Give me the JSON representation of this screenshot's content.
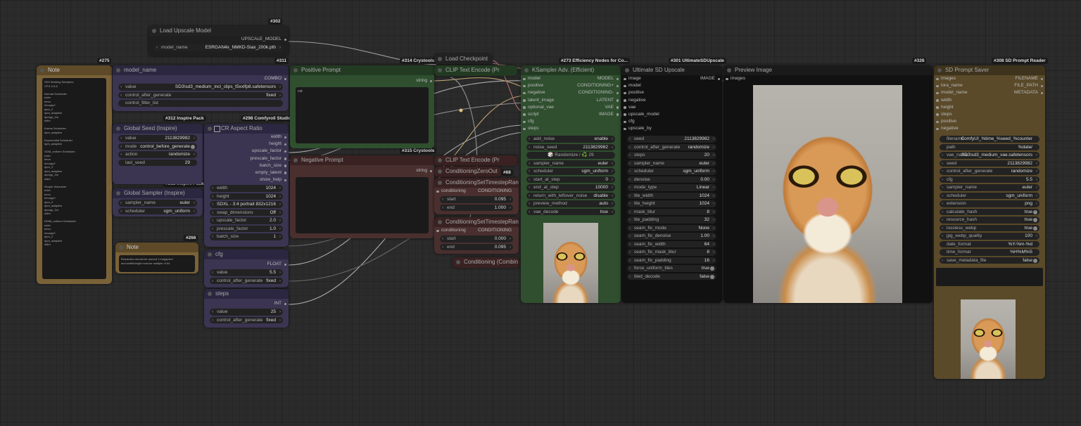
{
  "badges": {
    "b302": "#302",
    "b275": "#275",
    "b311": "#311",
    "b314": "#314 Crystools",
    "b273": "#273 Efficiency Nodes for Co...",
    "b301": "#301 UltimateSDUpscale",
    "b326": "#326",
    "b308": "#308 SD Prompt Reader",
    "b312": "#312 Inspire Pack",
    "b298": "#298 Comfyroll Studio",
    "b315": "#315 Crystools",
    "b313": "#313 Inspire Pack",
    "b266": "#266",
    "b68": "#68",
    "b322": "#322"
  },
  "upscale_loader": {
    "title": "Load Upscale Model",
    "output": "UPSCALE_MODEL",
    "model_label": "model_name",
    "model_value": "ESRGAN4x_NMKD-Siax_200k.pth"
  },
  "note1": {
    "title": "Note",
    "text": "SD3 Working Samplers\nCFG 4.5-6\n\nNormal Scheduler\neuler\nheun\nheunpp2\ndpm_2\ndpm_adaptive\ndpmpp_2m\nddim\n\nKarras Scheduler\ndpm_adaptive\n\nExponential Scheduler\ndpm_adaptive\n\nSGM_uniform Scheduler\neuler\nheun\nheunpp2\ndpm_2\ndpm_adaptive\ndpmpp_2m\nddim\n\nSimple Scheduler\neuler\nheun\nheunpp2\ndpm_2\ndpm_adaptive\ndpmpp_2m\nddim\n\nDDIM_uniform Scheduler\neuler\nheun\nheunpp2\ndpm_2\ndpm_adaptive\nddim"
  },
  "model_name_node": {
    "title": "model_name",
    "output": "COMBO",
    "value_label": "value",
    "value": "SD3\\sd3_medium_incl_clips_t5xxlfp8.safetensors",
    "cag_label": "control_after_generate",
    "cag_value": "fixed",
    "filter_label": "control_filter_list"
  },
  "global_seed": {
    "title": "Global Seed (Inspire)",
    "value_label": "value",
    "value": "2113829982",
    "mode_label": "mode",
    "mode_value": "control_before_generate",
    "action_label": "action",
    "action_value": "randomize",
    "last_seed_label": "last_seed",
    "last_seed_value": "29"
  },
  "global_sampler": {
    "title": "Global Sampler (Inspire)",
    "sampler_label": "sampler_name",
    "sampler_value": "euler",
    "scheduler_label": "scheduler",
    "scheduler_value": "sgm_uniform"
  },
  "note2": {
    "title": "Note",
    "text": "Resolution should be around 1 megapixel\nand width/height must be multiple of 64"
  },
  "aspect": {
    "title": "CR Aspect Ratio",
    "outputs": [
      "width",
      "height",
      "upscale_factor",
      "prescale_factor",
      "batch_size",
      "empty_latent",
      "show_help"
    ],
    "widgets": [
      {
        "label": "width",
        "value": "1024"
      },
      {
        "label": "height",
        "value": "1024"
      },
      {
        "label": "aspect_ratio",
        "value": "SDXL - 3:4 portrait 832x1216"
      },
      {
        "label": "swap_dimensions",
        "value": "Off"
      },
      {
        "label": "upscale_factor",
        "value": "2.0"
      },
      {
        "label": "prescale_factor",
        "value": "1.0"
      },
      {
        "label": "batch_size",
        "value": "1"
      }
    ]
  },
  "cfg_node": {
    "title": "cfg",
    "output": "FLOAT",
    "value_label": "value",
    "value": "5.5",
    "cag_label": "control_after_generate",
    "cag_value": "fixed"
  },
  "steps_node": {
    "title": "steps",
    "output": "INT",
    "value_label": "value",
    "value": "25",
    "cag_label": "control_after_generate",
    "cag_value": "fixed"
  },
  "positive": {
    "title": "Positive Prompt",
    "output": "string",
    "text": "cat"
  },
  "negative": {
    "title": "Negative Prompt",
    "output": "string",
    "text": ""
  },
  "load_checkpoint": {
    "title": "Load Checkpoint"
  },
  "clip_encode_1": {
    "title": "CLIP Text Encode (Pr"
  },
  "clip_encode_2": {
    "title": "CLIP Text Encode (Pr"
  },
  "zero_out": {
    "title": "ConditioningZeroOut"
  },
  "ts_range_1": {
    "title": "ConditioningSetTimestepRange",
    "input": "conditioning",
    "output": "CONDITIONING",
    "start_label": "start",
    "start_value": "0.095",
    "end_label": "end",
    "end_value": "1.000"
  },
  "ts_range_2": {
    "title": "ConditioningSetTimestepRange",
    "input": "conditioning",
    "output": "CONDITIONING",
    "start_label": "start",
    "start_value": "0.000",
    "end_label": "end",
    "end_value": "0.095"
  },
  "combine": {
    "title": "Conditioning (Combin"
  },
  "ksampler": {
    "title": "KSampler Adv. (Efficient)",
    "inputs": [
      "model",
      "positive",
      "negative",
      "latent_image",
      "optional_vae",
      "script",
      "cfg",
      "steps"
    ],
    "outputs": [
      "MODEL",
      "CONDITIONING+",
      "CONDITIONING-",
      "LATENT",
      "VAE",
      "IMAGE"
    ],
    "widgets": [
      {
        "label": "add_noise",
        "value": "enable"
      },
      {
        "label": "noise_seed",
        "value": "2113829982"
      },
      {
        "label": "",
        "value": "🎲 Randomize / ♻️ 29"
      },
      {
        "label": "sampler_name",
        "value": "euler"
      },
      {
        "label": "scheduler",
        "value": "sgm_uniform"
      },
      {
        "label": "start_at_step",
        "value": "0"
      },
      {
        "label": "end_at_step",
        "value": "10000"
      },
      {
        "label": "return_with_leftover_noise",
        "value": "disable"
      },
      {
        "label": "preview_method",
        "value": "auto"
      },
      {
        "label": "vae_decode",
        "value": "true"
      }
    ]
  },
  "ultimate": {
    "title": "Ultimate SD Upscale",
    "inputs": [
      "image",
      "model",
      "positive",
      "negative",
      "vae",
      "upscale_model",
      "cfg",
      "upscale_by"
    ],
    "output": "IMAGE",
    "widgets": [
      {
        "label": "seed",
        "value": "2113829982"
      },
      {
        "label": "control_after_generate",
        "value": "randomize"
      },
      {
        "label": "steps",
        "value": "20"
      },
      {
        "label": "sampler_name",
        "value": "euler"
      },
      {
        "label": "scheduler",
        "value": "sgm_uniform"
      },
      {
        "label": "denoise",
        "value": "0.00"
      },
      {
        "label": "mode_type",
        "value": "Linear"
      },
      {
        "label": "tile_width",
        "value": "1024"
      },
      {
        "label": "tile_height",
        "value": "1024"
      },
      {
        "label": "mask_blur",
        "value": "8"
      },
      {
        "label": "tile_padding",
        "value": "32"
      },
      {
        "label": "seam_fix_mode",
        "value": "None"
      },
      {
        "label": "seam_fix_denoise",
        "value": "1.00"
      },
      {
        "label": "seam_fix_width",
        "value": "64"
      },
      {
        "label": "seam_fix_mask_blur",
        "value": "8"
      },
      {
        "label": "seam_fix_padding",
        "value": "16"
      },
      {
        "label": "force_uniform_tiles",
        "value": "true"
      },
      {
        "label": "tiled_decode",
        "value": "false"
      }
    ]
  },
  "preview": {
    "title": "Preview Image",
    "input": "images"
  },
  "saver": {
    "title": "SD Prompt Saver",
    "inputs": [
      "images",
      "lora_name",
      "model_name",
      "width",
      "height",
      "steps",
      "positive",
      "negative"
    ],
    "outputs": [
      "FILENAME",
      "FILE_PATH",
      "METADATA"
    ],
    "widgets": [
      {
        "label": "filename",
        "value": "ComfyUI_%time_%seed_%counter"
      },
      {
        "label": "path",
        "value": "%date/"
      },
      {
        "label": "vae_name",
        "value": "SD3\\sd3_medium_vae.safetensors"
      },
      {
        "label": "seed",
        "value": "2113829982"
      },
      {
        "label": "control_after_generate",
        "value": "randomize"
      },
      {
        "label": "cfg",
        "value": "5.5"
      },
      {
        "label": "sampler_name",
        "value": "euler"
      },
      {
        "label": "scheduler",
        "value": "sgm_uniform"
      },
      {
        "label": "extension",
        "value": "png"
      },
      {
        "label": "calculate_hash",
        "value": "true"
      },
      {
        "label": "resource_hash",
        "value": "true"
      },
      {
        "label": "lossless_webp",
        "value": "true"
      },
      {
        "label": "jpg_webp_quality",
        "value": "100"
      },
      {
        "label": "date_format",
        "value": "%Y-%m-%d"
      },
      {
        "label": "time_format",
        "value": "%H%M%S"
      },
      {
        "label": "save_metadata_file",
        "value": "false"
      }
    ]
  },
  "colors": {
    "canvas": "#2b2b2b",
    "positive_green": "#2f4f2f",
    "negative_red": "#4a2f2f",
    "purple": "#3b3552",
    "brown": "#5a4a2a",
    "note": "#4a3d28"
  },
  "cat_image": "orange tabby cat portrait"
}
